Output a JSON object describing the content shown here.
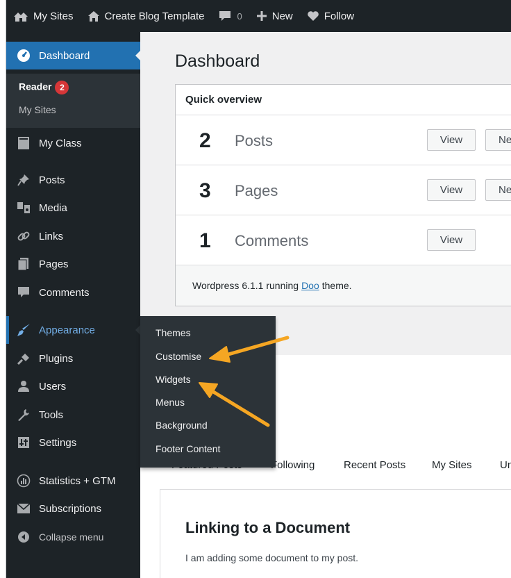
{
  "adminbar": {
    "my_sites": "My Sites",
    "site_name": "Create Blog Template",
    "comments_count": "0",
    "new_label": "New",
    "follow_label": "Follow"
  },
  "sidebar": {
    "dashboard": "Dashboard",
    "reader": "Reader",
    "reader_badge": "2",
    "my_sites": "My Sites",
    "items": [
      {
        "label": "My Class",
        "icon": "book-icon"
      },
      {
        "label": "Posts",
        "icon": "pin-icon"
      },
      {
        "label": "Media",
        "icon": "media-icon"
      },
      {
        "label": "Links",
        "icon": "link-icon"
      },
      {
        "label": "Pages",
        "icon": "pages-icon"
      },
      {
        "label": "Comments",
        "icon": "comment-icon"
      },
      {
        "label": "Appearance",
        "icon": "brush-icon"
      },
      {
        "label": "Plugins",
        "icon": "plug-icon"
      },
      {
        "label": "Users",
        "icon": "user-icon"
      },
      {
        "label": "Tools",
        "icon": "wrench-icon"
      },
      {
        "label": "Settings",
        "icon": "settings-icon"
      },
      {
        "label": "Statistics + GTM",
        "icon": "stats-icon"
      },
      {
        "label": "Subscriptions",
        "icon": "mail-icon"
      },
      {
        "label": "Collapse menu",
        "icon": "collapse-icon"
      }
    ]
  },
  "flyout": {
    "items": [
      "Themes",
      "Customise",
      "Widgets",
      "Menus",
      "Background",
      "Footer Content"
    ]
  },
  "main": {
    "title": "Dashboard",
    "overview": {
      "heading": "Quick overview",
      "rows": [
        {
          "count": "2",
          "label": "Posts",
          "view": "View",
          "new": "Ne"
        },
        {
          "count": "3",
          "label": "Pages",
          "view": "View",
          "new": "Ne"
        },
        {
          "count": "1",
          "label": "Comments",
          "view": "View"
        }
      ],
      "footer_pre": "Wordpress 6.1.1 running",
      "footer_link": "Doo",
      "footer_post": "theme."
    },
    "tabs": [
      "Featured Posts",
      "Following",
      "Recent Posts",
      "My Sites",
      "Unr"
    ],
    "post": {
      "title": "Linking to a Document",
      "excerpt": "I am adding some document to my post."
    }
  },
  "colors": {
    "admin_bg": "#1d2327",
    "accent": "#2271b1",
    "arrow": "#f5a623",
    "badge": "#d63638"
  }
}
